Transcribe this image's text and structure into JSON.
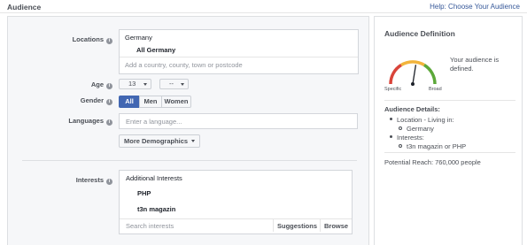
{
  "header": {
    "title": "Audience",
    "help_link": "Help: Choose Your Audience"
  },
  "form": {
    "locations": {
      "label": "Locations",
      "country": "Germany",
      "region": "All Germany",
      "placeholder": "Add a country, county, town or postcode"
    },
    "age": {
      "label": "Age",
      "min": "13",
      "max": "--"
    },
    "gender": {
      "label": "Gender",
      "options": [
        "All",
        "Men",
        "Women"
      ],
      "selected": "All"
    },
    "languages": {
      "label": "Languages",
      "placeholder": "Enter a language..."
    },
    "more_demographics": "More Demographics",
    "interests": {
      "label": "Interests",
      "header": "Additional Interests",
      "items": [
        "PHP",
        "t3n magazin"
      ],
      "placeholder": "Search interests",
      "suggestions": "Suggestions",
      "browse": "Browse"
    }
  },
  "definition": {
    "title": "Audience Definition",
    "gauge_specific": "Specific",
    "gauge_broad": "Broad",
    "gauge_level": 0.55,
    "status": "Your audience is defined.",
    "details_title": "Audience Details:",
    "location_label": "Location - Living in:",
    "location_value": "Germany",
    "interests_label": "Interests:",
    "interests_value": "t3n magazin or PHP",
    "reach": "Potential Reach: 760,000 people"
  },
  "colors": {
    "accent": "#4267b2",
    "link": "#365899",
    "gauge_red": "#d9443a",
    "gauge_yellow": "#f2b43c",
    "gauge_green": "#5ca839"
  }
}
